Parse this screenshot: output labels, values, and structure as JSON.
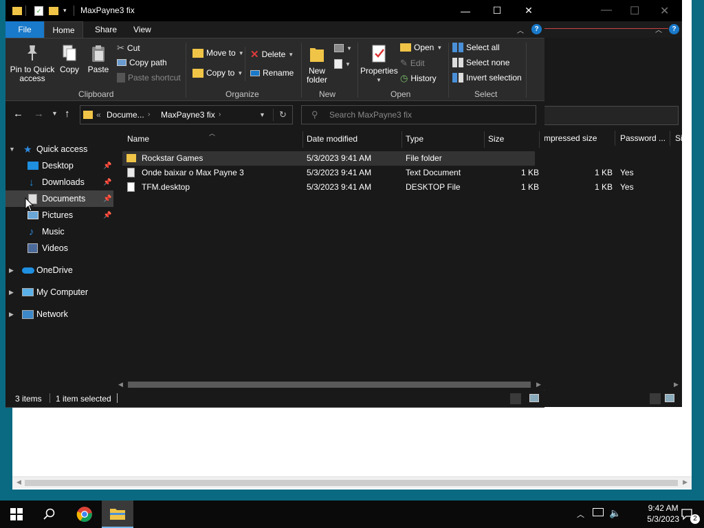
{
  "window": {
    "title": "MaxPayne3 fix",
    "minimize": "—",
    "maximize": "☐",
    "close": "✕"
  },
  "ribbon": {
    "tabs": [
      "File",
      "Home",
      "Share",
      "View"
    ],
    "help": "?",
    "clipboard": {
      "group_label": "Clipboard",
      "pin_label_1": "Pin to Quick",
      "pin_label_2": "access",
      "copy": "Copy",
      "paste": "Paste",
      "cut": "Cut",
      "copy_path": "Copy path",
      "paste_shortcut": "Paste shortcut"
    },
    "organize": {
      "group_label": "Organize",
      "move_to": "Move to",
      "copy_to": "Copy to",
      "delete": "Delete",
      "rename": "Rename"
    },
    "new": {
      "group_label": "New",
      "new_folder_1": "New",
      "new_folder_2": "folder"
    },
    "open": {
      "group_label": "Open",
      "properties": "Properties",
      "open": "Open",
      "edit": "Edit",
      "history": "History"
    },
    "select": {
      "group_label": "Select",
      "select_all": "Select all",
      "select_none": "Select none",
      "invert_selection": "Invert selection"
    }
  },
  "address": {
    "overflow": "«",
    "crumbs": [
      "Docume...",
      "MaxPayne3 fix"
    ],
    "search_placeholder": "Search MaxPayne3 fix"
  },
  "navpane": {
    "quick_access": "Quick access",
    "items": [
      "Desktop",
      "Downloads",
      "Documents",
      "Pictures",
      "Music",
      "Videos"
    ],
    "onedrive": "OneDrive",
    "my_computer": "My Computer",
    "network": "Network"
  },
  "columns": {
    "name": "Name",
    "date_modified": "Date modified",
    "type": "Type",
    "size": "Size"
  },
  "files": [
    {
      "name": "Rockstar Games",
      "date": "5/3/2023 9:41 AM",
      "type": "File folder",
      "size": ""
    },
    {
      "name": "Onde baixar o Max Payne 3",
      "date": "5/3/2023 9:41 AM",
      "type": "Text Document",
      "size": "1 KB"
    },
    {
      "name": "TFM.desktop",
      "date": "5/3/2023 9:41 AM",
      "type": "DESKTOP File",
      "size": "1 KB"
    }
  ],
  "status": {
    "items": "3 items",
    "selected": "1 item selected"
  },
  "back_window": {
    "col_compressed": "mpressed size",
    "col_password": "Password ...",
    "col_extra": "Si",
    "rows": [
      {
        "size": "1 KB",
        "password": "Yes"
      },
      {
        "size": "1 KB",
        "password": "Yes"
      }
    ]
  },
  "taskbar": {
    "time": "9:42 AM",
    "date": "5/3/2023",
    "notifications": "2"
  },
  "colors": {
    "accent": "#1979ca",
    "folder": "#f0c447",
    "background": "#191919"
  }
}
